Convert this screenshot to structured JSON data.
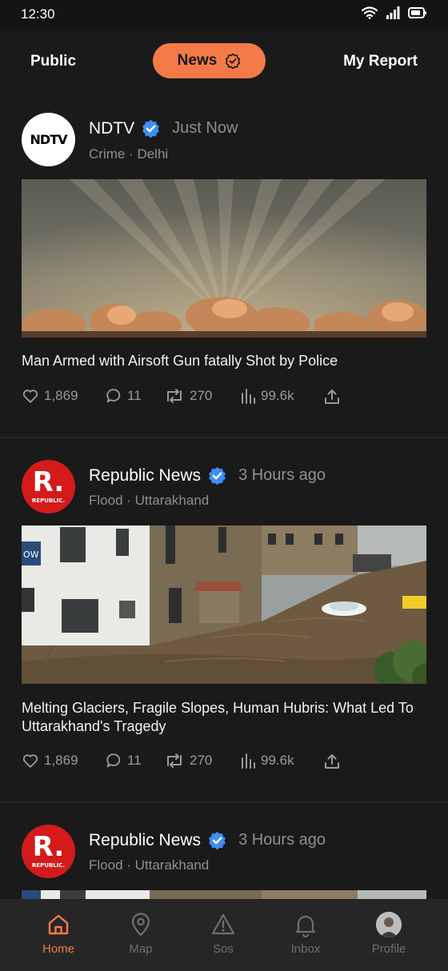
{
  "status_bar": {
    "time": "12:30"
  },
  "top_tabs": {
    "public": "Public",
    "news": "News",
    "my_report": "My Report"
  },
  "posts": [
    {
      "avatar_text": "NDTV",
      "source": "NDTV",
      "time": "Just Now",
      "category": "Crime",
      "location": "Delhi",
      "meta": "Crime · Delhi",
      "headline": "Man Armed with Airsoft Gun fatally Shot by Police",
      "likes": "1,869",
      "comments": "11",
      "reposts": "270",
      "views": "99.6k"
    },
    {
      "avatar_text": "R.",
      "avatar_subtext": "REPUBLIC.",
      "source": "Republic News",
      "time": "3 Hours ago",
      "category": "Flood",
      "location": "Uttarakhand",
      "meta": "Flood · Uttarakhand",
      "image_sign": "OW",
      "headline": "Melting Glaciers, Fragile Slopes, Human Hubris: What Led To Uttarakhand's Tragedy",
      "likes": "1,869",
      "comments": "11",
      "reposts": "270",
      "views": "99.6k"
    },
    {
      "avatar_text": "R.",
      "avatar_subtext": "REPUBLIC.",
      "source": "Republic News",
      "time": "3 Hours ago",
      "category": "Flood",
      "location": "Uttarakhand",
      "meta": "Flood · Uttarakhand"
    }
  ],
  "bottom_nav": {
    "items": [
      {
        "label": "Home",
        "icon": "home-icon",
        "active": true
      },
      {
        "label": "Map",
        "icon": "map-pin-icon",
        "active": false
      },
      {
        "label": "Sos",
        "icon": "warning-icon",
        "active": false
      },
      {
        "label": "Inbox",
        "icon": "bell-icon",
        "active": false
      },
      {
        "label": "Profile",
        "icon": "profile-avatar",
        "active": false
      }
    ]
  },
  "colors": {
    "accent": "#f47b47",
    "background": "#1a1a1a",
    "verified": "#3b8ff0",
    "muted_text": "#8f8f8f"
  }
}
